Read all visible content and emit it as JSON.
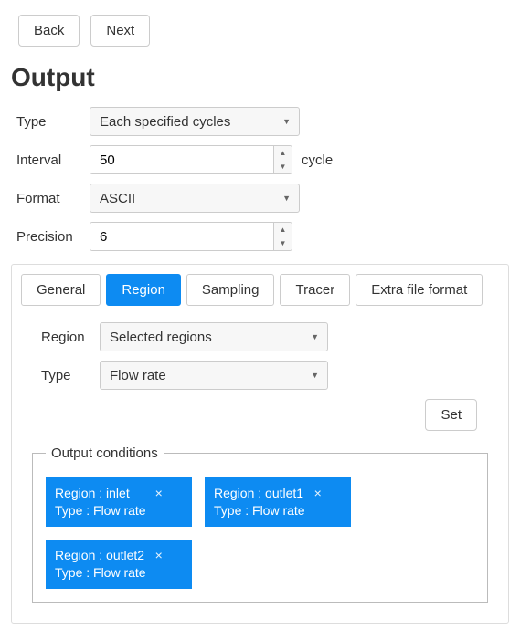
{
  "nav": {
    "back": "Back",
    "next": "Next"
  },
  "title": "Output",
  "fields": {
    "type_label": "Type",
    "type_value": "Each specified cycles",
    "interval_label": "Interval",
    "interval_value": "50",
    "interval_suffix": "cycle",
    "format_label": "Format",
    "format_value": "ASCII",
    "precision_label": "Precision",
    "precision_value": "6"
  },
  "tabs": {
    "general": "General",
    "region": "Region",
    "sampling": "Sampling",
    "tracer": "Tracer",
    "extra": "Extra file format",
    "active": "region"
  },
  "region_tab": {
    "region_label": "Region",
    "region_value": "Selected regions",
    "type_label": "Type",
    "type_value": "Flow rate",
    "set_button": "Set",
    "group_label": "Output conditions",
    "region_prefix": "Region : ",
    "type_prefix": "Type : ",
    "close_glyph": "×",
    "conditions": [
      {
        "region": "inlet",
        "type": "Flow rate"
      },
      {
        "region": "outlet1",
        "type": "Flow rate"
      },
      {
        "region": "outlet2",
        "type": "Flow rate"
      }
    ]
  }
}
